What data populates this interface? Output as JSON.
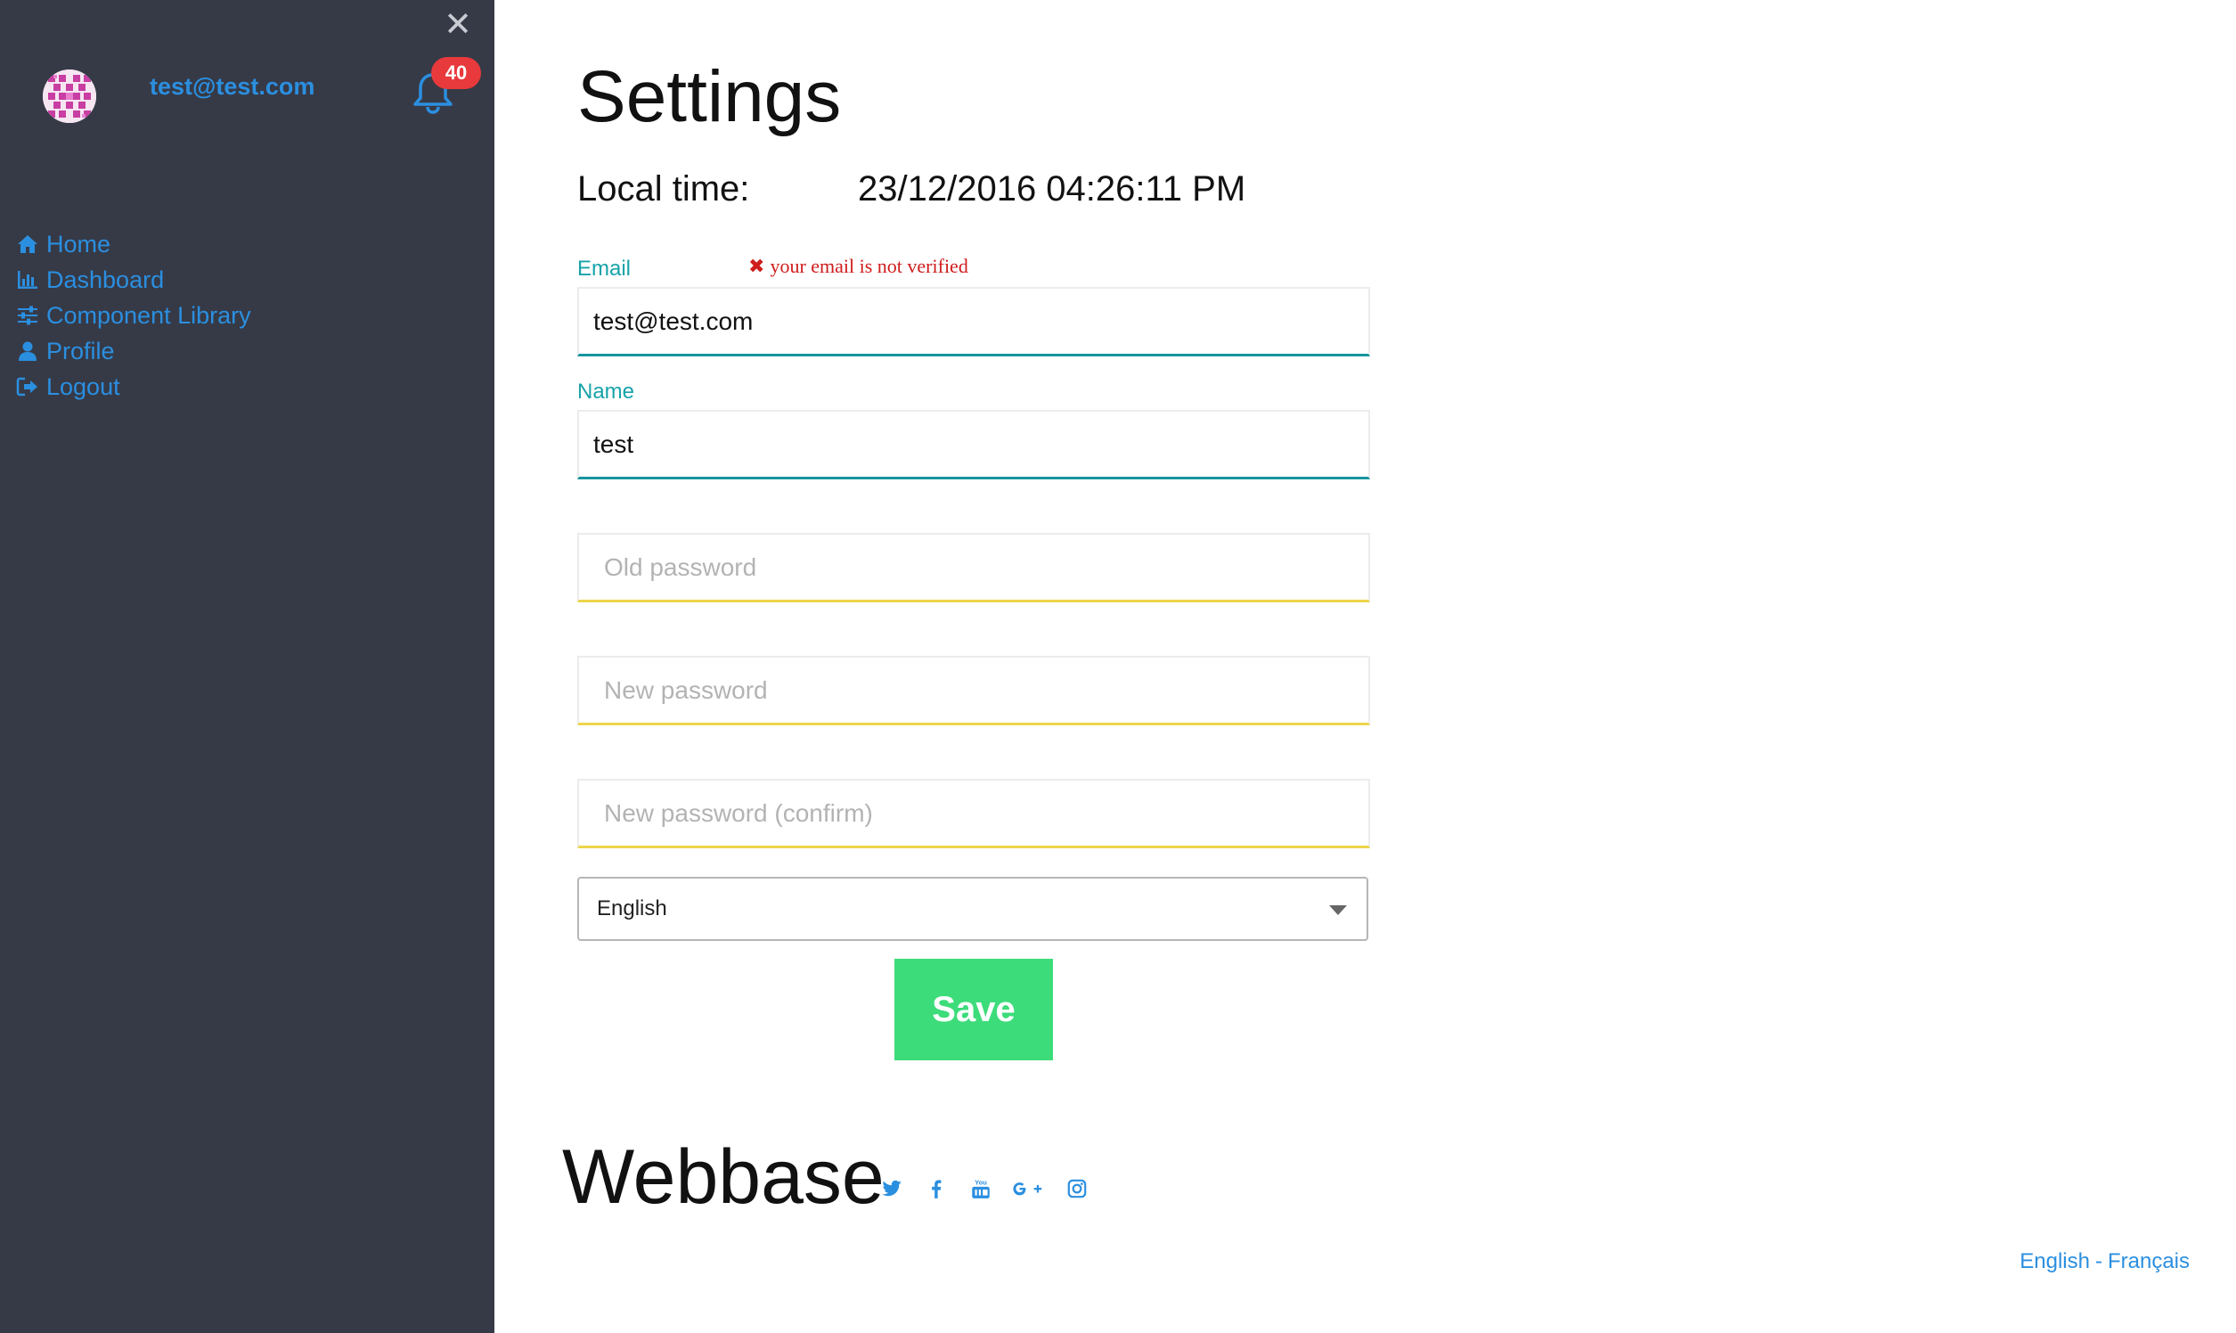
{
  "sidebar": {
    "user_email": "test@test.com",
    "notification_count": "40",
    "close_glyph": "✕",
    "items": [
      {
        "label": "Home",
        "icon": "home-icon"
      },
      {
        "label": "Dashboard",
        "icon": "bar-chart-icon"
      },
      {
        "label": "Component Library",
        "icon": "sliders-icon"
      },
      {
        "label": "Profile",
        "icon": "user-icon"
      },
      {
        "label": "Logout",
        "icon": "logout-icon"
      }
    ]
  },
  "main": {
    "title": "Settings",
    "local_time_label": "Local time:",
    "local_time_value": "23/12/2016 04:26:11 PM",
    "email_label": "Email",
    "email_error": "your email is not verified",
    "email_value": "test@test.com",
    "name_label": "Name",
    "name_value": "test",
    "old_password_placeholder": "Old password",
    "new_password_placeholder": "New password",
    "confirm_password_placeholder": "New password (confirm)",
    "language_selected": "English",
    "save_label": "Save"
  },
  "footer": {
    "brand": "Webbase",
    "social": [
      "twitter-icon",
      "facebook-icon",
      "youtube-icon",
      "google-plus-icon",
      "instagram-icon"
    ],
    "lang_english": "English",
    "lang_separator": "-",
    "lang_french": "Français"
  },
  "colors": {
    "sidebar_bg": "#363a47",
    "accent_blue": "#2b8fe0",
    "label_teal": "#17a3a9",
    "error_red": "#cf1d1d",
    "save_green": "#3ddc7a",
    "badge_red": "#e8393c",
    "password_underline": "#ecd54a"
  }
}
